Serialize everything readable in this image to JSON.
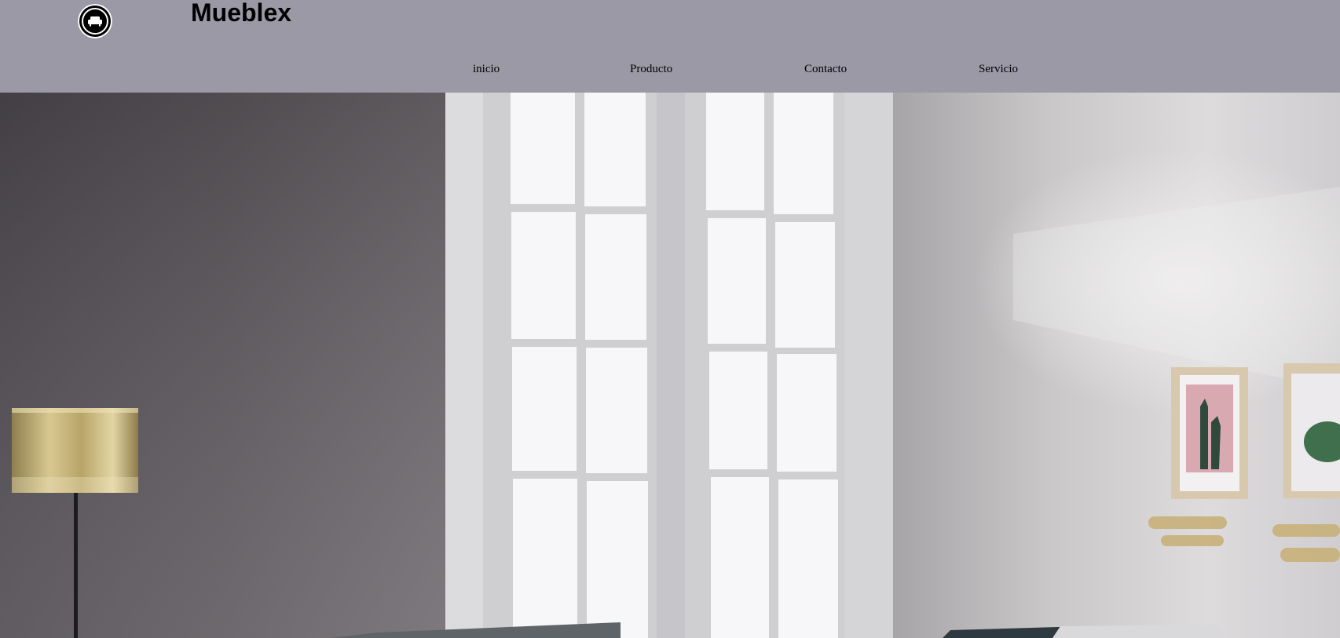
{
  "header": {
    "brand": "Mueblex",
    "logo_icon": "sofa-icon"
  },
  "nav": {
    "items": [
      {
        "label": "inicio"
      },
      {
        "label": "Producto"
      },
      {
        "label": "Contacto"
      },
      {
        "label": "Servicio"
      }
    ]
  },
  "hero": {
    "image_subject": "living-room-interior",
    "colors": {
      "header_bg": "#9b99a6",
      "wall_dark": "#5a565b",
      "window_frame": "#d7d7da"
    }
  }
}
